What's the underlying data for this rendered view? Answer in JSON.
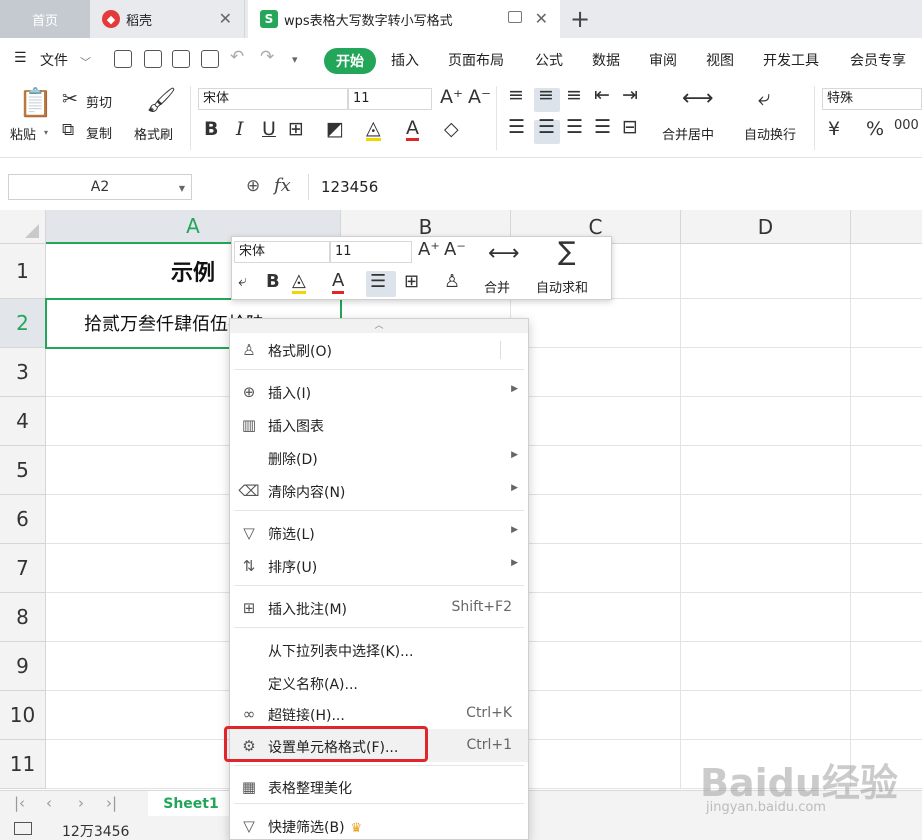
{
  "tabs": {
    "home": "首页",
    "daoke": "稻壳",
    "doc": "wps表格大写数字转小写格式"
  },
  "menubar": {
    "file": "文件",
    "items": [
      "开始",
      "插入",
      "页面布局",
      "公式",
      "数据",
      "审阅",
      "视图",
      "开发工具",
      "会员专享"
    ]
  },
  "ribbon": {
    "paste": "粘贴",
    "cut": "剪切",
    "copy": "复制",
    "format_painter": "格式刷",
    "font_name": "宋体",
    "font_size": "11",
    "merge_center": "合并居中",
    "wrap_text": "自动换行",
    "number_format": "特殊"
  },
  "formula_bar": {
    "name_box": "A2",
    "fx": "fx",
    "value": "123456"
  },
  "grid": {
    "columns": [
      "A",
      "B",
      "C",
      "D"
    ],
    "rows": [
      "1",
      "2",
      "3",
      "4",
      "5",
      "6",
      "7",
      "8",
      "9",
      "10",
      "11"
    ],
    "a1": "示例",
    "a2": "拾贰万叁仟肆佰伍拾陆"
  },
  "mini_toolbar": {
    "font_name": "宋体",
    "font_size": "11",
    "merge": "合并",
    "autosum": "自动求和"
  },
  "context_menu": {
    "items": [
      {
        "label": "格式刷(O)"
      },
      {
        "label": "插入(I)"
      },
      {
        "label": "插入图表"
      },
      {
        "label": "删除(D)"
      },
      {
        "label": "清除内容(N)"
      },
      {
        "label": "筛选(L)"
      },
      {
        "label": "排序(U)"
      },
      {
        "label": "插入批注(M)",
        "shortcut": "Shift+F2"
      },
      {
        "label": "从下拉列表中选择(K)..."
      },
      {
        "label": "定义名称(A)..."
      },
      {
        "label": "超链接(H)...",
        "shortcut": "Ctrl+K"
      },
      {
        "label": "设置单元格格式(F)...",
        "shortcut": "Ctrl+1"
      },
      {
        "label": "表格整理美化"
      },
      {
        "label": "快捷筛选(B)"
      }
    ]
  },
  "sheets": {
    "active": "Sheet1"
  },
  "status": {
    "text": "12万3456"
  },
  "watermark": {
    "main": "Baidu经验",
    "sub": "jingyan.baidu.com"
  },
  "colors": {
    "accent": "#23a55a",
    "highlight": "#e0262b"
  }
}
